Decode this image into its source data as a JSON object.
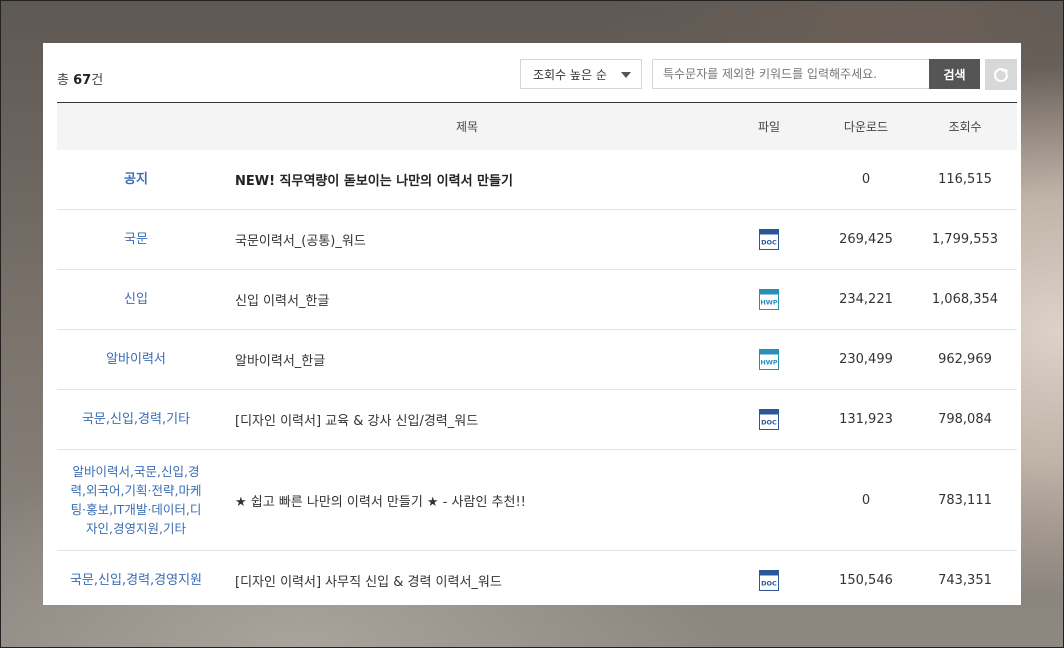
{
  "toolbar": {
    "total_prefix": "총 ",
    "total_count": "67",
    "total_suffix": "건",
    "sort_value": "조회수 높은 순",
    "search_placeholder": "특수문자를 제외한 키워드를 입력해주세요.",
    "search_label": "검색",
    "reset_icon": "refresh-icon"
  },
  "table": {
    "headers": {
      "category": "",
      "title": "제목",
      "file": "파일",
      "downloads": "다운로드",
      "views": "조회수"
    },
    "rows": [
      {
        "category": "공지",
        "title": "NEW! 직무역량이 돋보이는 나만의 이력서 만들기",
        "file": "",
        "downloads": "0",
        "views": "116,515"
      },
      {
        "category": "국문",
        "title": "국문이력서_(공통)_워드",
        "file": "doc",
        "downloads": "269,425",
        "views": "1,799,553"
      },
      {
        "category": "신입",
        "title": "신입 이력서_한글",
        "file": "hwp",
        "downloads": "234,221",
        "views": "1,068,354"
      },
      {
        "category": "알바이력서",
        "title": "알바이력서_한글",
        "file": "hwp",
        "downloads": "230,499",
        "views": "962,969"
      },
      {
        "category": "국문,신입,경력,기타",
        "title": "[디자인 이력서] 교육 & 강사 신입/경력_워드",
        "file": "doc",
        "downloads": "131,923",
        "views": "798,084"
      },
      {
        "category": "알바이력서,국문,신입,경력,외국어,기획·전략,마케팅·홍보,IT개발·데이터,디자인,경영지원,기타",
        "title": "★ 쉽고 빠른 나만의 이력서 만들기 ★ - 사람인 추천!!",
        "file": "",
        "downloads": "0",
        "views": "783,111"
      },
      {
        "category": "국문,신입,경력,경영지원",
        "title": "[디자인 이력서] 사무직 신입 & 경력 이력서_워드",
        "file": "doc",
        "downloads": "150,546",
        "views": "743,351"
      }
    ]
  },
  "file_labels": {
    "doc": "DOC",
    "hwp": "HWP"
  },
  "colors": {
    "category_link": "#3a6db5",
    "doc_icon": "#2b5797",
    "hwp_icon": "#2a8fb6",
    "search_button": "#555555",
    "reset_button": "#d8d8d8"
  }
}
